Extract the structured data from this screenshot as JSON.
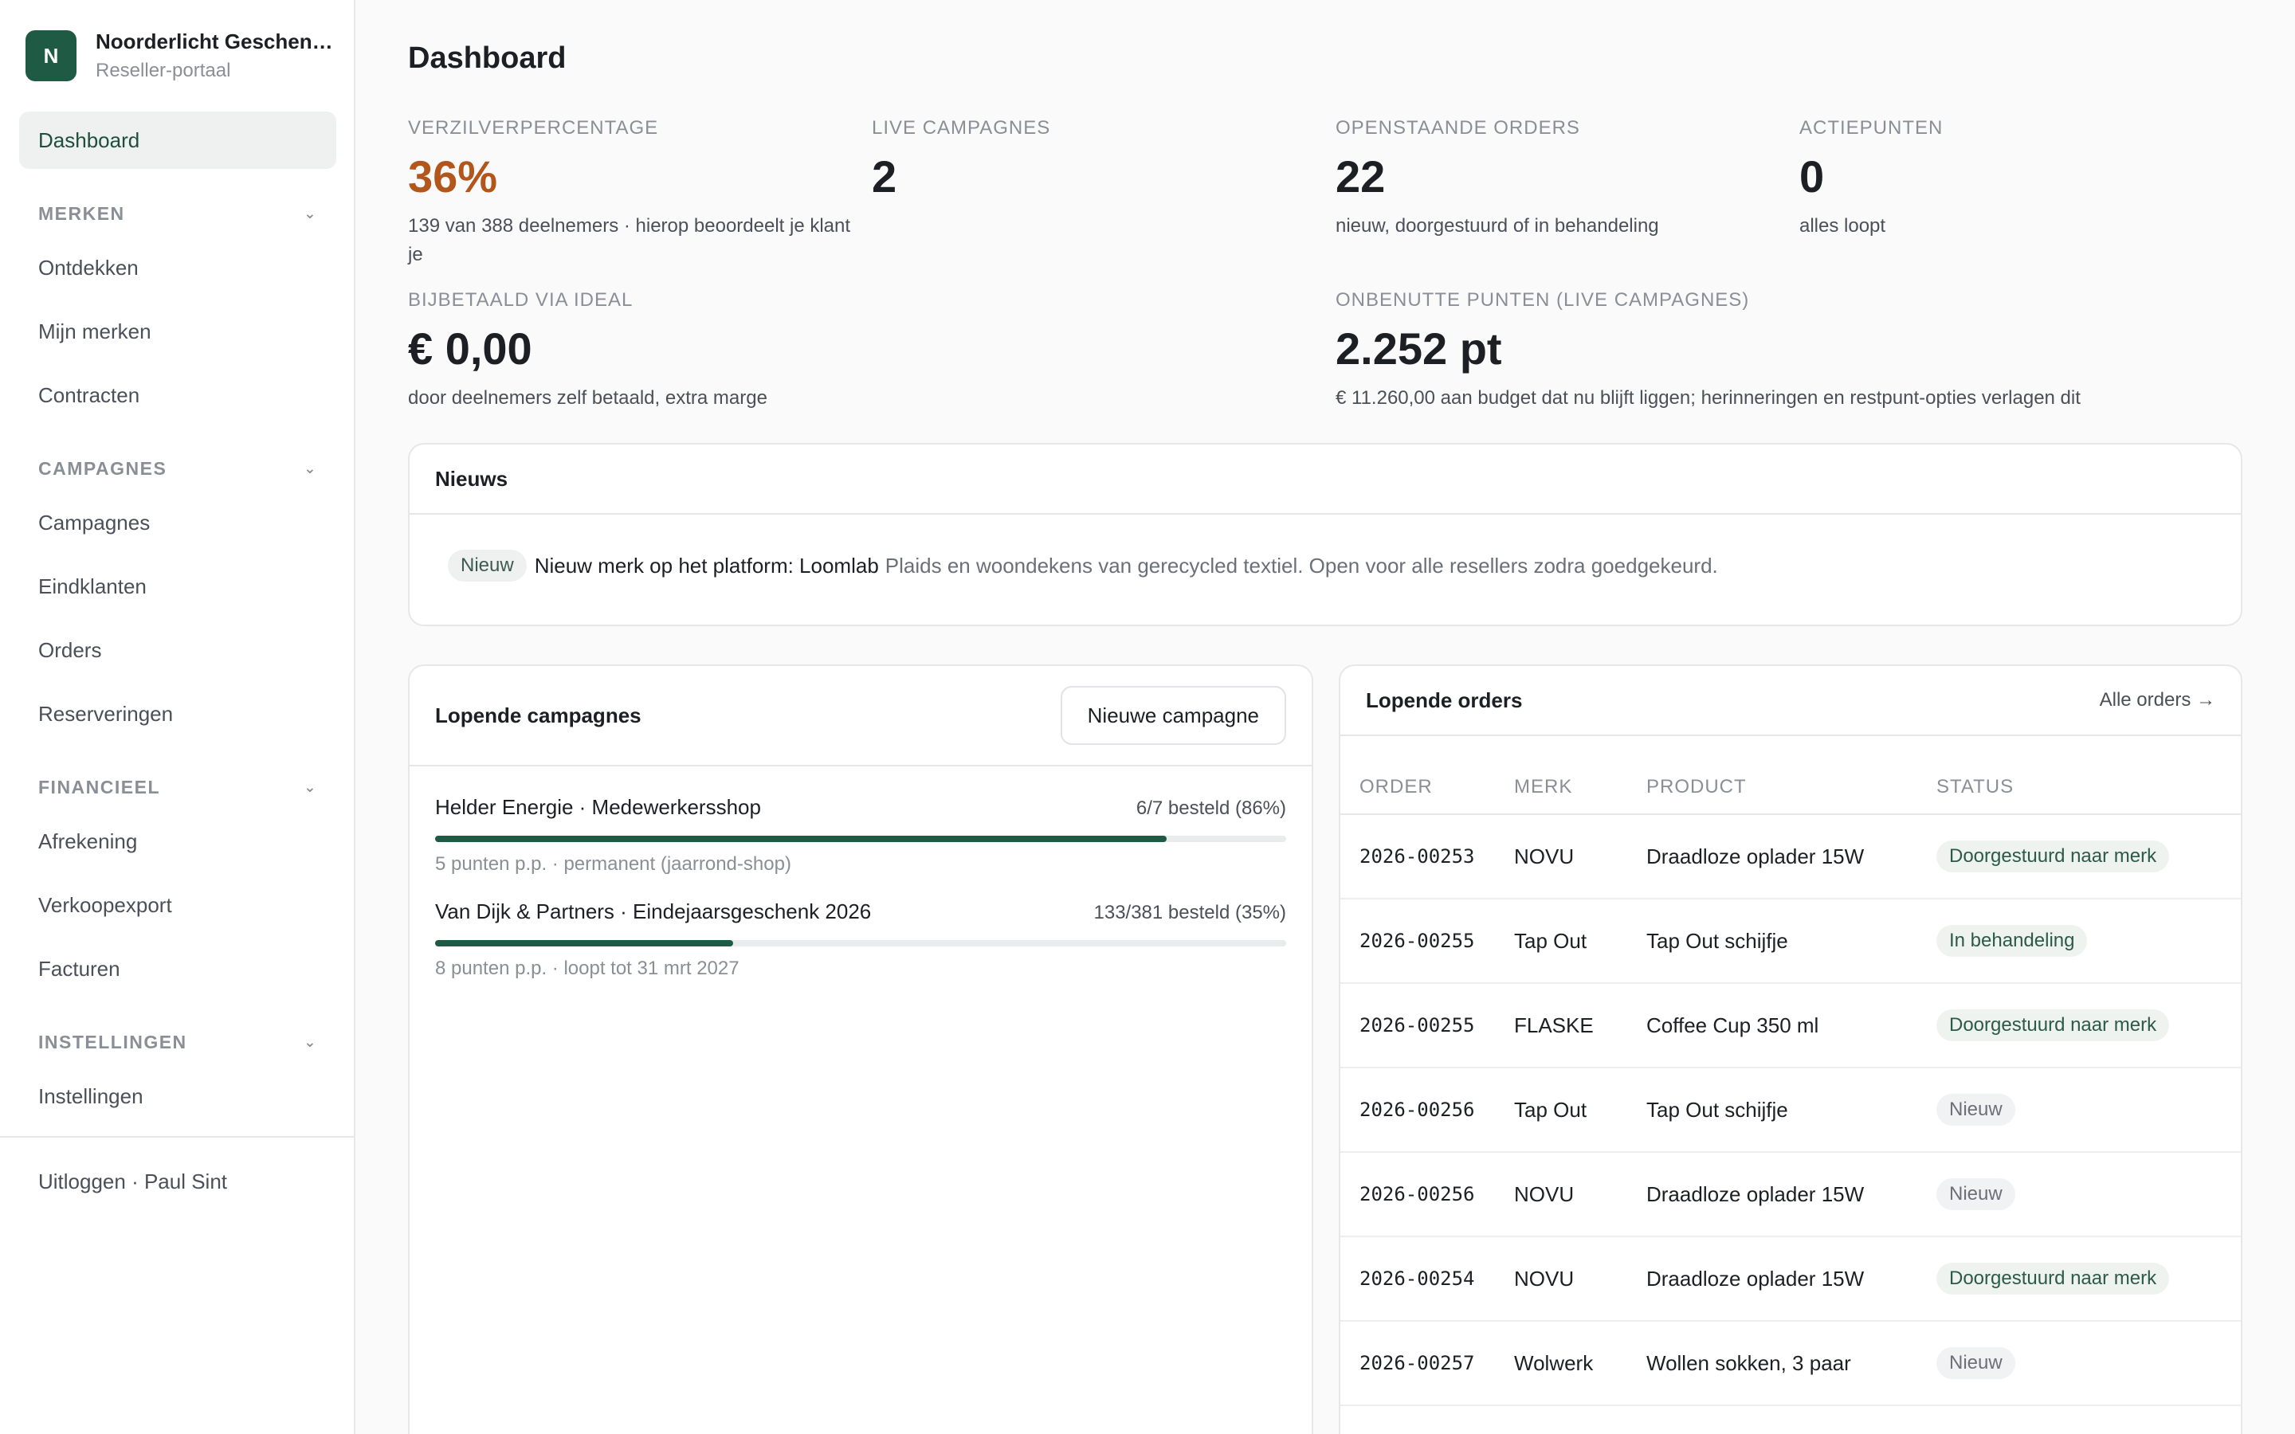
{
  "brand": {
    "initial": "N",
    "name": "Noorderlicht Geschenken",
    "subtitle": "Reseller-portaal"
  },
  "nav": {
    "dashboard": "Dashboard",
    "groups": [
      {
        "label": "MERKEN",
        "items": [
          "Ontdekken",
          "Mijn merken",
          "Contracten"
        ]
      },
      {
        "label": "CAMPAGNES",
        "items": [
          "Campagnes",
          "Eindklanten",
          "Orders",
          "Reserveringen"
        ]
      },
      {
        "label": "FINANCIEEL",
        "items": [
          "Afrekening",
          "Verkoopexport",
          "Facturen"
        ]
      },
      {
        "label": "INSTELLINGEN",
        "items": [
          "Instellingen"
        ]
      }
    ],
    "logout": "Uitloggen · Paul Sint"
  },
  "page": {
    "title": "Dashboard"
  },
  "stats": {
    "redemption": {
      "label": "VERZILVERPERCENTAGE",
      "value": "36%",
      "desc": "139 van 388 deelnemers · hierop beoordeelt je klant je"
    },
    "live": {
      "label": "LIVE CAMPAGNES",
      "value": "2",
      "desc": ""
    },
    "orders": {
      "label": "OPENSTAANDE ORDERS",
      "value": "22",
      "desc": "nieuw, doorgestuurd of in behandeling"
    },
    "actions": {
      "label": "ACTIEPUNTEN",
      "value": "0",
      "desc": "alles loopt"
    },
    "ideal": {
      "label": "BIJBETAALD VIA IDEAL",
      "value": "€ 0,00",
      "desc": "door deelnemers zelf betaald, extra marge"
    },
    "unused": {
      "label": "ONBENUTTE PUNTEN (LIVE CAMPAGNES)",
      "value": "2.252 pt",
      "desc": "€ 11.260,00 aan budget dat nu blijft liggen; herinneringen en restpunt-opties verlagen dit"
    }
  },
  "news": {
    "title": "Nieuws",
    "badge": "Nieuw",
    "headline": "Nieuw merk op het platform: Loomlab",
    "text": "Plaids en woondekens van gerecycled textiel. Open voor alle resellers zodra goedgekeurd."
  },
  "campaigns": {
    "title": "Lopende campagnes",
    "new_button": "Nieuwe campagne",
    "items": [
      {
        "name": "Helder Energie · Medewerkersshop",
        "progress": "6/7 besteld (86%)",
        "fraction": 0.86,
        "meta": "5 punten p.p. · permanent (jaarrond-shop)"
      },
      {
        "name": "Van Dijk & Partners · Eindejaarsgeschenk 2026",
        "progress": "133/381 besteld (35%)",
        "fraction": 0.35,
        "meta": "8 punten p.p. · loopt tot 31 mrt 2027"
      }
    ]
  },
  "orders": {
    "title": "Lopende orders",
    "all_link": "Alle orders →",
    "columns": [
      "ORDER",
      "MERK",
      "PRODUCT",
      "STATUS"
    ],
    "rows": [
      {
        "order": "2026-00253",
        "brand": "NOVU",
        "product": "Draadloze oplader 15W",
        "status": "Doorgestuurd naar merk",
        "kind": "forwarded"
      },
      {
        "order": "2026-00255",
        "brand": "Tap Out",
        "product": "Tap Out schijfje",
        "status": "In behandeling",
        "kind": "processing"
      },
      {
        "order": "2026-00255",
        "brand": "FLASKE",
        "product": "Coffee Cup 350 ml",
        "status": "Doorgestuurd naar merk",
        "kind": "forwarded"
      },
      {
        "order": "2026-00256",
        "brand": "Tap Out",
        "product": "Tap Out schijfje",
        "status": "Nieuw",
        "kind": "new"
      },
      {
        "order": "2026-00256",
        "brand": "NOVU",
        "product": "Draadloze oplader 15W",
        "status": "Nieuw",
        "kind": "new"
      },
      {
        "order": "2026-00254",
        "brand": "NOVU",
        "product": "Draadloze oplader 15W",
        "status": "Doorgestuurd naar merk",
        "kind": "forwarded"
      },
      {
        "order": "2026-00257",
        "brand": "Wolwerk",
        "product": "Wollen sokken, 3 paar",
        "status": "Nieuw",
        "kind": "new"
      }
    ]
  }
}
